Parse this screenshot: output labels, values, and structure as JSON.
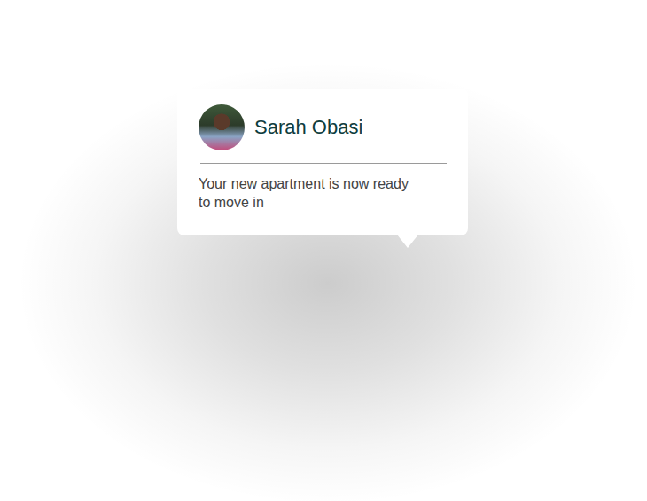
{
  "notification": {
    "sender": "Sarah Obasi",
    "message": "Your new apartment is now ready to move in"
  }
}
